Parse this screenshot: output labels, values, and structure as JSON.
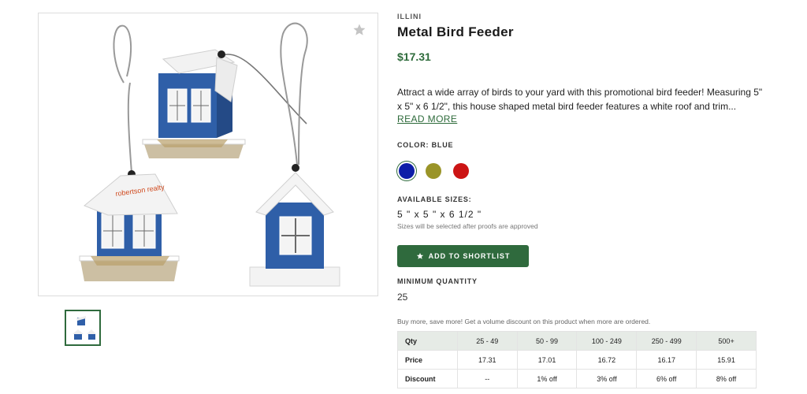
{
  "product": {
    "brand": "ILLINI",
    "title": "Metal Bird Feeder",
    "price": "$17.31",
    "description": "Attract a wide array of birds to your yard with this promotional bird feeder! Measuring 5\" x 5\" x 6 1/2\", this house shaped metal bird feeder features a white roof and trim...",
    "read_more_label": "READ MORE",
    "imprint_text": "robertson realty"
  },
  "color": {
    "label": "COLOR: BLUE",
    "options": [
      {
        "name": "blue",
        "hex": "#0d1ea8"
      },
      {
        "name": "olive",
        "hex": "#9a9428"
      },
      {
        "name": "red",
        "hex": "#cc1414"
      }
    ],
    "selected": "blue"
  },
  "sizes": {
    "label": "AVAILABLE SIZES:",
    "value": "5 \" x 5 \" x 6 1/2 \"",
    "note": "Sizes will be selected after proofs are approved"
  },
  "shortlist": {
    "label": "ADD TO SHORTLIST",
    "icon": "star-icon"
  },
  "minimum_quantity": {
    "label": "MINIMUM QUANTITY",
    "value": "25"
  },
  "pricing": {
    "note": "Buy more, save more! Get a volume discount on this product when more are ordered.",
    "qty_label": "Qty",
    "price_label": "Price",
    "discount_label": "Discount",
    "tiers": [
      {
        "qty": "25 - 49",
        "price": "17.31",
        "discount": "--"
      },
      {
        "qty": "50 - 99",
        "price": "17.01",
        "discount": "1% off"
      },
      {
        "qty": "100 - 249",
        "price": "16.72",
        "discount": "3% off"
      },
      {
        "qty": "250 - 499",
        "price": "16.17",
        "discount": "6% off"
      },
      {
        "qty": "500+",
        "price": "15.91",
        "discount": "8% off"
      }
    ]
  },
  "colors": {
    "accent": "#2f6a3d",
    "price_text": "#2e6b3b",
    "feeder_blue": "#2a5aa6"
  }
}
